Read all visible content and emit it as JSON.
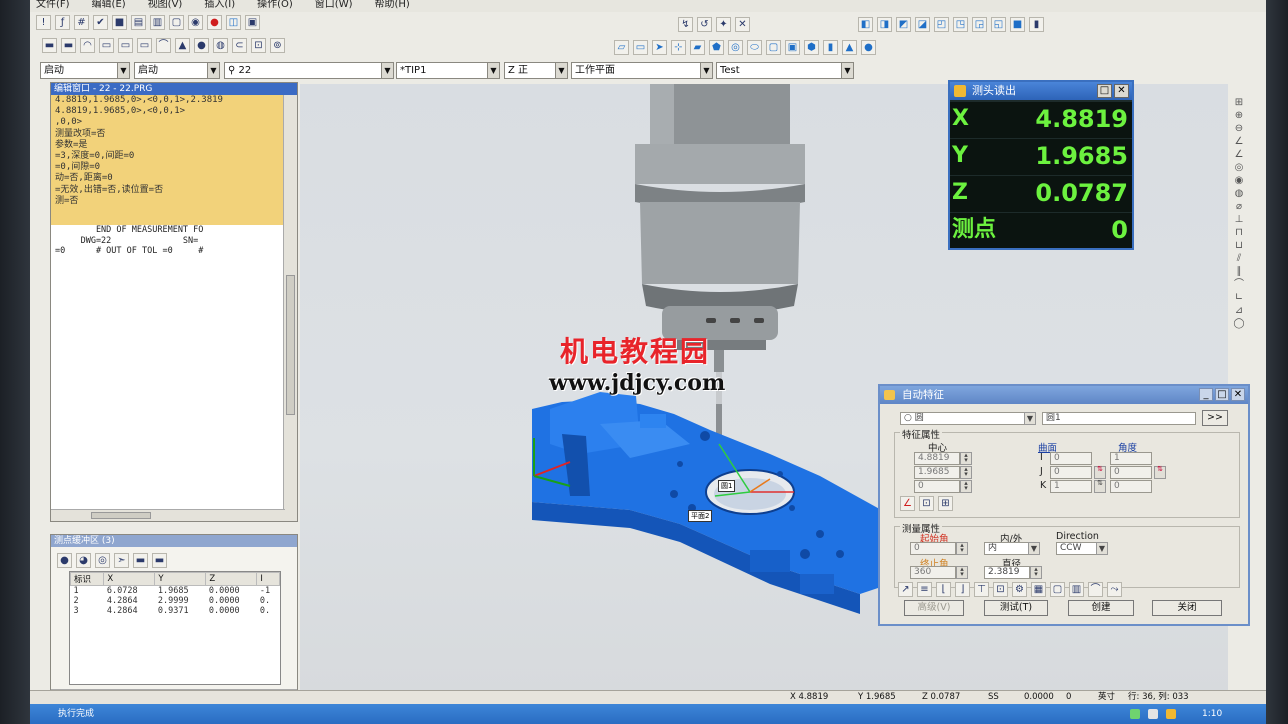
{
  "menu": [
    "文件(F)",
    "编辑(E)",
    "视图(V)",
    "插入(I)",
    "操作(O)",
    "窗口(W)",
    "帮助(H)"
  ],
  "combos": {
    "mode1": "启动",
    "mode2": "启动",
    "probe": "22",
    "tip": "*TIP1",
    "view": "Z 正",
    "plane": "工作平面",
    "name": "Test"
  },
  "editor": {
    "title": "编辑窗口 - 22 - 22.PRG",
    "lines": [
      "4.8819,1.9685,0>,<0,0,1>,2.3819",
      "4.8819,1.9685,0>,<0,0,1>",
      ",0,0>",
      "",
      "测量改项=否",
      "参数=是",
      "=3,深度=0,间距=0",
      "=0,间隙=0",
      "动=否,距离=0",
      "=无效,出错=否,读位置=否",
      "测=否"
    ],
    "report_lines": [
      "        END OF MEASUREMENT FO",
      "     DWG=22              SN=",
      "=0      # OUT OF TOL =0     # "
    ]
  },
  "points_panel": {
    "title": "测点缓冲区 (3)",
    "headers": [
      "标识",
      "X",
      "Y",
      "Z",
      "I"
    ],
    "rows": [
      [
        "1",
        "6.0728",
        "1.9685",
        "0.0000",
        "-1"
      ],
      [
        "2",
        "4.2864",
        "2.9999",
        "0.0000",
        "0."
      ],
      [
        "3",
        "4.2864",
        "0.9371",
        "0.0000",
        "0."
      ]
    ]
  },
  "readout": {
    "title": "测头读出",
    "x_label": "X",
    "x_value": "4.8819",
    "y_label": "Y",
    "y_value": "1.9685",
    "z_label": "Z",
    "z_value": "0.0787",
    "hits_label": "测点",
    "hits_value": "0"
  },
  "dialog": {
    "title": "自动特征",
    "feature_type": "圆",
    "feature_name": "圆1",
    "next_btn": ">>",
    "feature_group": "特征属性",
    "center_label": "中心",
    "surface_label": "曲面",
    "angle_label": "角度",
    "cx": "4.8819",
    "cy": "1.9685",
    "cz": "0",
    "i_label": "I",
    "j_label": "J",
    "k_label": "K",
    "i_val": "0",
    "j_val": "0",
    "k_val": "1",
    "ai_val": "1",
    "aj_val": "0",
    "ak_val": "0",
    "measure_group": "测量属性",
    "start_angle_label": "起始角",
    "start_angle": "0",
    "inout_label": "内/外",
    "inout": "内",
    "direction_label": "Direction",
    "direction": "CCW",
    "end_angle_label": "终止角",
    "end_angle": "360",
    "diameter_label": "直径",
    "diameter": "2.3819",
    "btn_advanced": "高级(V)",
    "btn_test": "测试(T)",
    "btn_create": "创建",
    "btn_close": "关闭"
  },
  "watermark": {
    "cn": "机电教程园",
    "url": "www.jdjcy.com"
  },
  "model_tags": {
    "circle": "圆1",
    "plane": "平面2"
  },
  "status": {
    "x": "X 4.8819",
    "y": "Y 1.9685",
    "z": "Z 0.0787",
    "ss": "SS",
    "val1": "0.0000",
    "val2": "0",
    "unit": "英寸",
    "line": "行: 36, 列: 033",
    "message": "执行完成"
  },
  "taskbar": {
    "clock": "1:10"
  },
  "colors": {
    "part": "#1e6ee0",
    "readout_text": "#6cf23f",
    "code_bg": "#f2d27a",
    "watermark_red": "#e8242a"
  }
}
